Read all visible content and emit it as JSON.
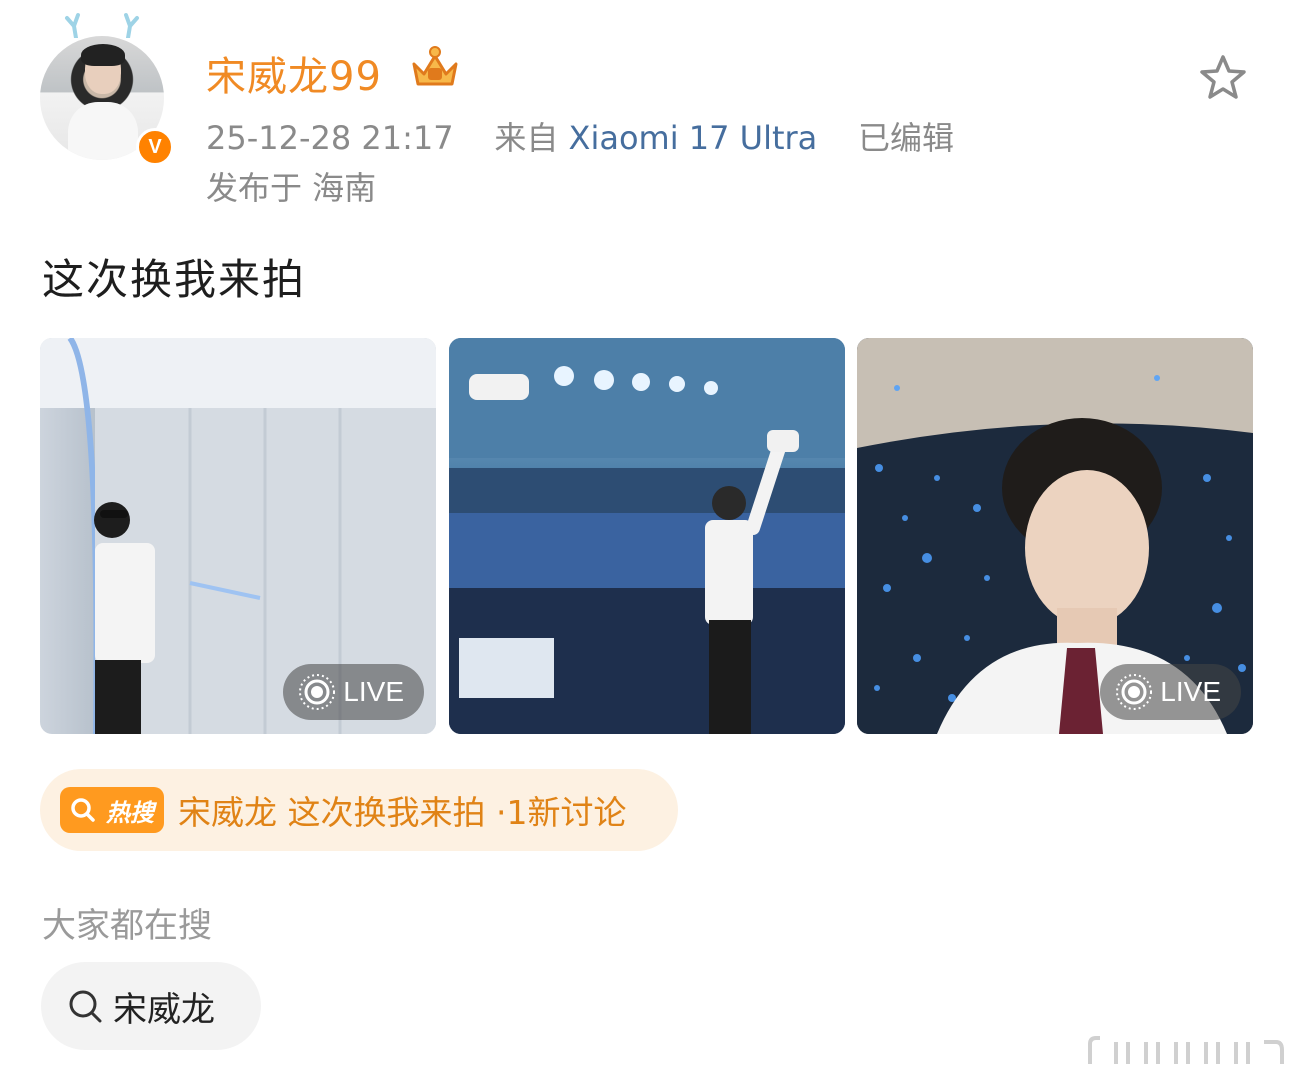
{
  "post": {
    "username": "宋威龙99",
    "timestamp": "25-12-28 21:17",
    "source_prefix": "来自",
    "device": "Xiaomi 17 Ultra",
    "edited": "已编辑",
    "location": "发布于 海南",
    "text": "这次换我来拍",
    "photos": [
      {
        "live_label": "LIVE",
        "has_live": true
      },
      {
        "has_live": false
      },
      {
        "live_label": "LIVE",
        "has_live": true
      }
    ]
  },
  "hot_search": {
    "badge_label": "热搜",
    "text": "宋威龙 这次换我来拍 ·1新讨论"
  },
  "related": {
    "title": "大家都在搜",
    "chip_label": "宋威龙"
  },
  "icons": {
    "verified": "verified-badge-icon",
    "member": "crown-icon",
    "favorite": "star-icon",
    "live": "live-photo-icon",
    "search": "search-icon"
  },
  "colors": {
    "username": "#f08a24",
    "device_link": "#466e9e",
    "hot_accent": "#ff9a1f",
    "hot_bg": "#fdf1e2"
  }
}
